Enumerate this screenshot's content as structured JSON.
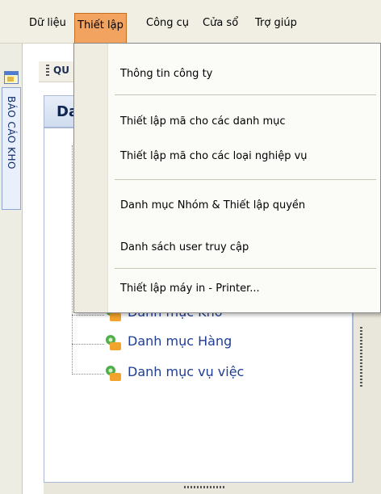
{
  "menubar": {
    "items": [
      "Dữ liệu",
      "Thiết lập",
      "Công cụ",
      "Cửa sổ",
      "Trợ giúp"
    ],
    "active": "Thiết lập"
  },
  "dropdown": {
    "items": [
      "Thông tin công ty",
      "Thiết lập mã cho các danh mục",
      "Thiết lập mã cho các loại nghiệp vụ",
      "Danh mục Nhóm & Thiết lập quyền",
      "Danh sách user truy cập",
      "Thiết lập máy in - Printer..."
    ]
  },
  "side_tab": {
    "label": "BÁO CÁO KHO"
  },
  "panel": {
    "toolbar_label": "QU",
    "header_label": "Da"
  },
  "tree": {
    "items": [
      "Danh mục Kho",
      "Danh mục Hàng",
      "Danh mục vụ việc"
    ]
  },
  "colors": {
    "menu_active_bg": "#f2a35f",
    "tree_text": "#1f3e93",
    "menubar_bg": "#f1efe4"
  }
}
